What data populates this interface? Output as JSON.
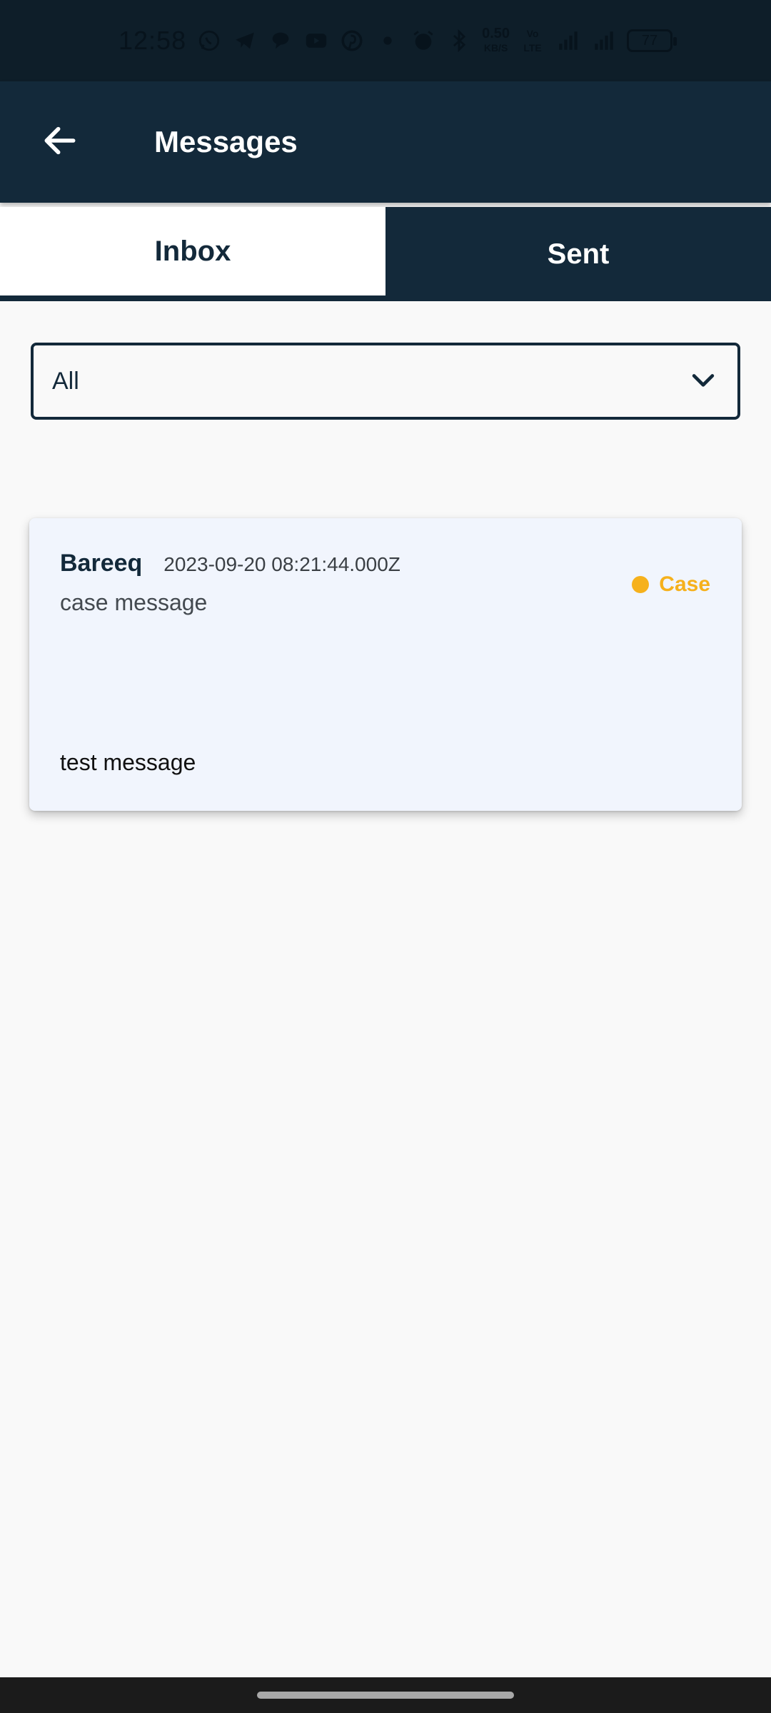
{
  "status_bar": {
    "time": "12:58",
    "speed_value": "0.50",
    "speed_unit": "KB/S",
    "volte": "Vo LTE",
    "network": "4G",
    "battery": "77"
  },
  "app_bar": {
    "title": "Messages",
    "back_icon": "arrow-left-icon"
  },
  "tabs": [
    {
      "label": "Inbox",
      "active": true
    },
    {
      "label": "Sent",
      "active": false
    }
  ],
  "filter": {
    "value": "All",
    "icon": "chevron-down-icon"
  },
  "messages": [
    {
      "sender": "Bareeq",
      "timestamp": "2023-09-20 08:21:44.000Z",
      "subject": "case message",
      "badge": "Case",
      "body": "test message"
    }
  ],
  "colors": {
    "primary": "#13293a",
    "status_bar": "#0e1e29",
    "card_bg": "#f1f5fd",
    "badge": "#f6b11c",
    "page_bg": "#f9f9f9"
  }
}
